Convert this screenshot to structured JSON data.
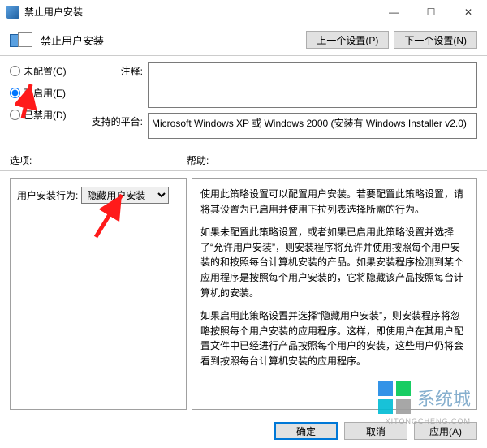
{
  "window": {
    "title": "禁止用户安装",
    "minimize": "—",
    "maximize": "☐",
    "close": "✕"
  },
  "header": {
    "title": "禁止用户安装",
    "prev": "上一个设置(P)",
    "next": "下一个设置(N)"
  },
  "radios": {
    "not_configured": "未配置(C)",
    "enabled": "已启用(E)",
    "disabled": "已禁用(D)",
    "selected": "enabled"
  },
  "fields": {
    "comment_label": "注释:",
    "comment_value": "",
    "platform_label": "支持的平台:",
    "platform_value": "Microsoft Windows XP 或 Windows 2000 (安装有 Windows Installer v2.0)"
  },
  "mid": {
    "options": "选项:",
    "help": "帮助:"
  },
  "options": {
    "behavior_label": "用户安装行为:",
    "behavior_value": "隐藏用户安装"
  },
  "help": {
    "p1": "使用此策略设置可以配置用户安装。若要配置此策略设置，请将其设置为已启用并使用下拉列表选择所需的行为。",
    "p2": "如果未配置此策略设置，或者如果已启用此策略设置并选择了“允许用户安装”，则安装程序将允许并使用按照每个用户安装的和按照每台计算机安装的产品。如果安装程序检测到某个应用程序是按照每个用户安装的，它将隐藏该产品按照每台计算机的安装。",
    "p3": "如果启用此策略设置并选择“隐藏用户安装”，则安装程序将忽略按照每个用户安装的应用程序。这样，即使用户在其用户配置文件中已经进行产品按照每个用户的安装，这些用户仍将会看到按照每台计算机安装的应用程序。"
  },
  "footer": {
    "ok": "确定",
    "cancel": "取消",
    "apply": "应用(A)"
  },
  "watermark": {
    "text": "系统城",
    "sub": "XITONGCHENG.COM"
  }
}
